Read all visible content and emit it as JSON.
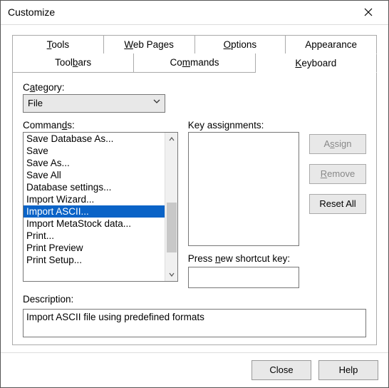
{
  "window": {
    "title": "Customize"
  },
  "tabs": {
    "top": [
      {
        "before": "",
        "u": "T",
        "after": "ools"
      },
      {
        "before": "",
        "u": "W",
        "after": "eb Pages"
      },
      {
        "before": "",
        "u": "O",
        "after": "ptions"
      },
      {
        "before": "Appearance",
        "u": "",
        "after": ""
      }
    ],
    "bottom": [
      {
        "before": "Tool",
        "u": "b",
        "after": "ars"
      },
      {
        "before": "Co",
        "u": "m",
        "after": "mands"
      },
      {
        "before": "",
        "u": "K",
        "after": "eyboard"
      }
    ]
  },
  "labels": {
    "category": {
      "before": "C",
      "u": "a",
      "after": "tegory:"
    },
    "commands": {
      "before": "Comman",
      "u": "d",
      "after": "s:"
    },
    "keyassign": {
      "before": "Key assignments:",
      "u": "",
      "after": ""
    },
    "press": {
      "before": "Press ",
      "u": "n",
      "after": "ew shortcut key:"
    },
    "description": {
      "before": "Description:",
      "u": "",
      "after": ""
    }
  },
  "category": {
    "value": "File"
  },
  "commands": [
    "Save Database As...",
    "Save",
    "Save As...",
    "Save All",
    "Database settings...",
    "Import Wizard...",
    "Import ASCII...",
    "Import MetaStock data...",
    "Print...",
    "Print Preview",
    "Print Setup..."
  ],
  "selectedCommandIndex": 6,
  "buttons": {
    "assign": {
      "before": "A",
      "u": "s",
      "after": "sign"
    },
    "remove": {
      "before": "",
      "u": "R",
      "after": "emove"
    },
    "resetall": {
      "before": "Reset All",
      "u": "",
      "after": ""
    }
  },
  "description": "Import ASCII file using predefined formats",
  "footer": {
    "close": "Close",
    "help": "Help"
  }
}
